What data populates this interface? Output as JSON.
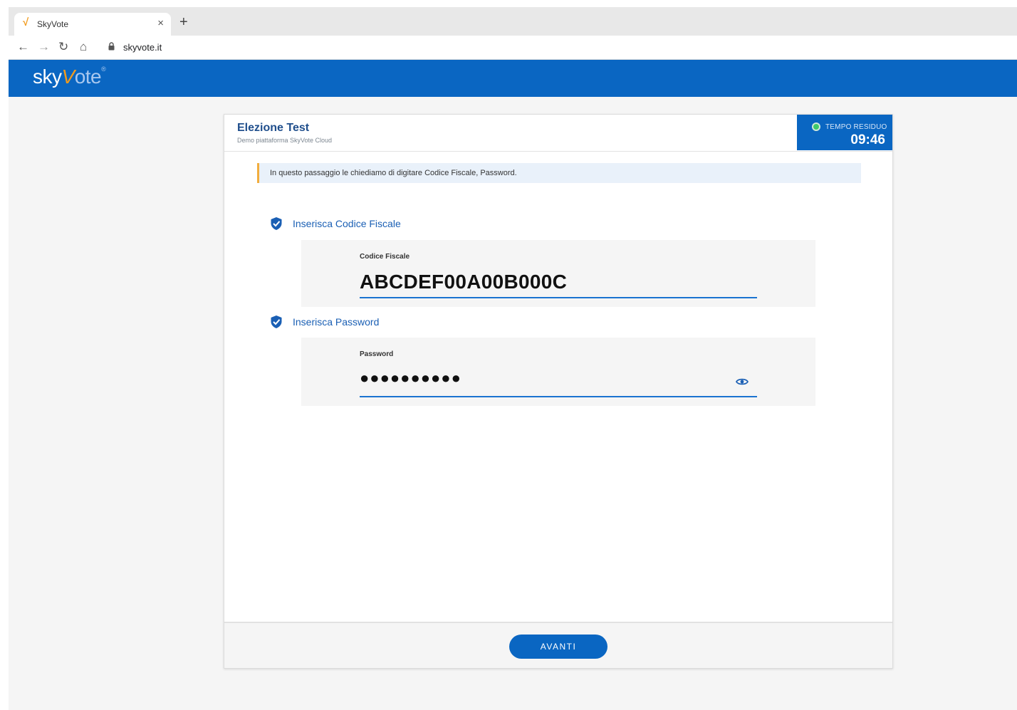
{
  "browser": {
    "tab_title": "SkyVote",
    "tab_favicon": "√",
    "url": "skyvote.it",
    "nav": {
      "back": "←",
      "forward": "→",
      "reload": "↻",
      "home": "⌂",
      "close": "×",
      "new_tab": "+"
    }
  },
  "logo": {
    "sky": "sky",
    "v": "V",
    "ote": "ote",
    "reg": "®"
  },
  "election": {
    "title": "Elezione Test",
    "subtitle": "Demo piattaforma SkyVote Cloud"
  },
  "timer": {
    "label": "TEMPO RESIDUO",
    "value": "09:46",
    "status_color": "#3ec96b"
  },
  "info_message": "In questo passaggio le chiediamo di digitare Codice Fiscale, Password.",
  "steps": [
    {
      "label": "Inserisca Codice Fiscale",
      "field_label": "Codice Fiscale",
      "field_value": "ABCDEF00A00B000C",
      "icon": "shield-check-icon"
    },
    {
      "label": "Inserisca Password",
      "field_label": "Password",
      "field_value": "●●●●●●●●●●",
      "icon": "shield-check-icon"
    }
  ],
  "actions": {
    "next_label": "AVANTI"
  },
  "colors": {
    "brand": "#0a66c2",
    "accent": "#f29b1d",
    "warning_border": "#f2ad3d"
  }
}
